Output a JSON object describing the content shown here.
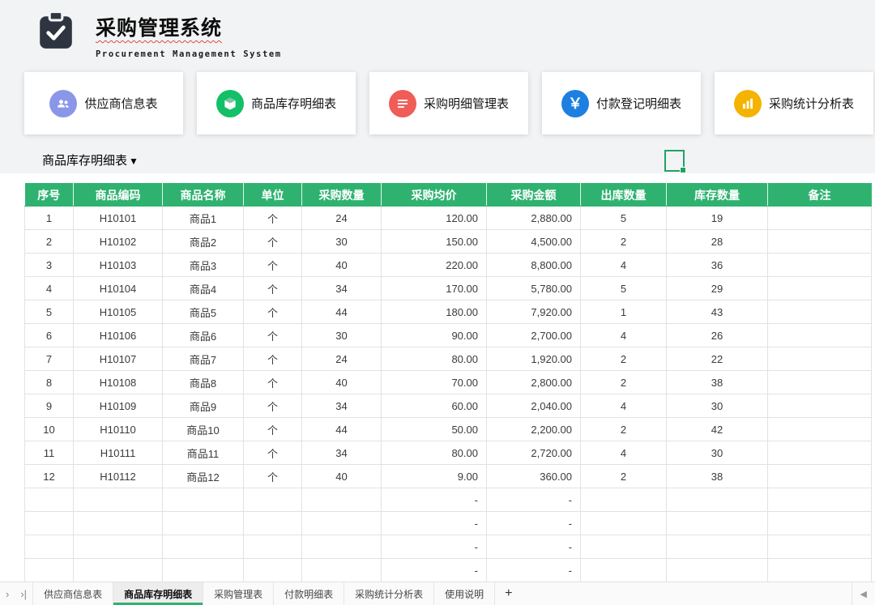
{
  "app": {
    "title": "采购管理系统",
    "subtitle": "Procurement Management System"
  },
  "nav_cards": [
    {
      "label": "供应商信息表",
      "icon": "users-icon",
      "color": "#8a97e8"
    },
    {
      "label": "商品库存明细表",
      "icon": "cube-icon",
      "color": "#13bf67"
    },
    {
      "label": "采购明细管理表",
      "icon": "list-icon",
      "color": "#f05c57"
    },
    {
      "label": "付款登记明细表",
      "icon": "payment-icon",
      "color": "#1d7fe0"
    },
    {
      "label": "采购统计分析表",
      "icon": "bar-chart-icon",
      "color": "#f3b300"
    }
  ],
  "table_section": {
    "caption": "商品库存明细表",
    "dropdown_arrow": "▼"
  },
  "table": {
    "headers": [
      "序号",
      "商品编码",
      "商品名称",
      "单位",
      "采购数量",
      "采购均价",
      "采购金额",
      "出库数量",
      "库存数量",
      "备注"
    ],
    "rows": [
      [
        "1",
        "H10101",
        "商品1",
        "个",
        "24",
        "120.00",
        "2,880.00",
        "5",
        "19",
        ""
      ],
      [
        "2",
        "H10102",
        "商品2",
        "个",
        "30",
        "150.00",
        "4,500.00",
        "2",
        "28",
        ""
      ],
      [
        "3",
        "H10103",
        "商品3",
        "个",
        "40",
        "220.00",
        "8,800.00",
        "4",
        "36",
        ""
      ],
      [
        "4",
        "H10104",
        "商品4",
        "个",
        "34",
        "170.00",
        "5,780.00",
        "5",
        "29",
        ""
      ],
      [
        "5",
        "H10105",
        "商品5",
        "个",
        "44",
        "180.00",
        "7,920.00",
        "1",
        "43",
        ""
      ],
      [
        "6",
        "H10106",
        "商品6",
        "个",
        "30",
        "90.00",
        "2,700.00",
        "4",
        "26",
        ""
      ],
      [
        "7",
        "H10107",
        "商品7",
        "个",
        "24",
        "80.00",
        "1,920.00",
        "2",
        "22",
        ""
      ],
      [
        "8",
        "H10108",
        "商品8",
        "个",
        "40",
        "70.00",
        "2,800.00",
        "2",
        "38",
        ""
      ],
      [
        "9",
        "H10109",
        "商品9",
        "个",
        "34",
        "60.00",
        "2,040.00",
        "4",
        "30",
        ""
      ],
      [
        "10",
        "H10110",
        "商品10",
        "个",
        "44",
        "50.00",
        "2,200.00",
        "2",
        "42",
        ""
      ],
      [
        "11",
        "H10111",
        "商品11",
        "个",
        "34",
        "80.00",
        "2,720.00",
        "4",
        "30",
        ""
      ],
      [
        "12",
        "H10112",
        "商品12",
        "个",
        "40",
        "9.00",
        "360.00",
        "2",
        "38",
        ""
      ],
      [
        "",
        "",
        "",
        "",
        "",
        "-",
        "-",
        "",
        "",
        ""
      ],
      [
        "",
        "",
        "",
        "",
        "",
        "-",
        "-",
        "",
        "",
        ""
      ],
      [
        "",
        "",
        "",
        "",
        "",
        "-",
        "-",
        "",
        "",
        ""
      ],
      [
        "",
        "",
        "",
        "",
        "",
        "-",
        "-",
        "",
        "",
        ""
      ]
    ]
  },
  "footer": {
    "nav_next": "›",
    "nav_last": "›|",
    "tabs": [
      {
        "label": "供应商信息表",
        "active": false
      },
      {
        "label": "商品库存明细表",
        "active": true
      },
      {
        "label": "采购管理表",
        "active": false
      },
      {
        "label": "付款明细表",
        "active": false
      },
      {
        "label": "采购统计分析表",
        "active": false
      },
      {
        "label": "使用说明",
        "active": false
      }
    ],
    "add_tab": "+",
    "scroll_left_arrow": "◀"
  },
  "colors": {
    "header_green": "#2fb270",
    "selection_green": "#21a366"
  }
}
